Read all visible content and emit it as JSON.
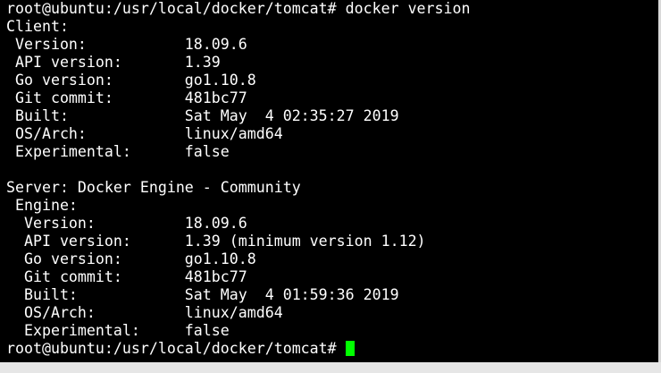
{
  "colors": {
    "background": "#000000",
    "text": "#ffffff",
    "cursor": "#00ff00"
  },
  "terminal": {
    "lines": [
      "root@ubuntu:/usr/local/docker/tomcat# docker version",
      "Client:",
      " Version:           18.09.6",
      " API version:       1.39",
      " Go version:        go1.10.8",
      " Git commit:        481bc77",
      " Built:             Sat May  4 02:35:27 2019",
      " OS/Arch:           linux/amd64",
      " Experimental:      false",
      "",
      "Server: Docker Engine - Community",
      " Engine:",
      "  Version:          18.09.6",
      "  API version:      1.39 (minimum version 1.12)",
      "  Go version:       go1.10.8",
      "  Git commit:       481bc77",
      "  Built:            Sat May  4 01:59:36 2019",
      "  OS/Arch:          linux/amd64",
      "  Experimental:     false"
    ],
    "prompt": "root@ubuntu:/usr/local/docker/tomcat# "
  }
}
